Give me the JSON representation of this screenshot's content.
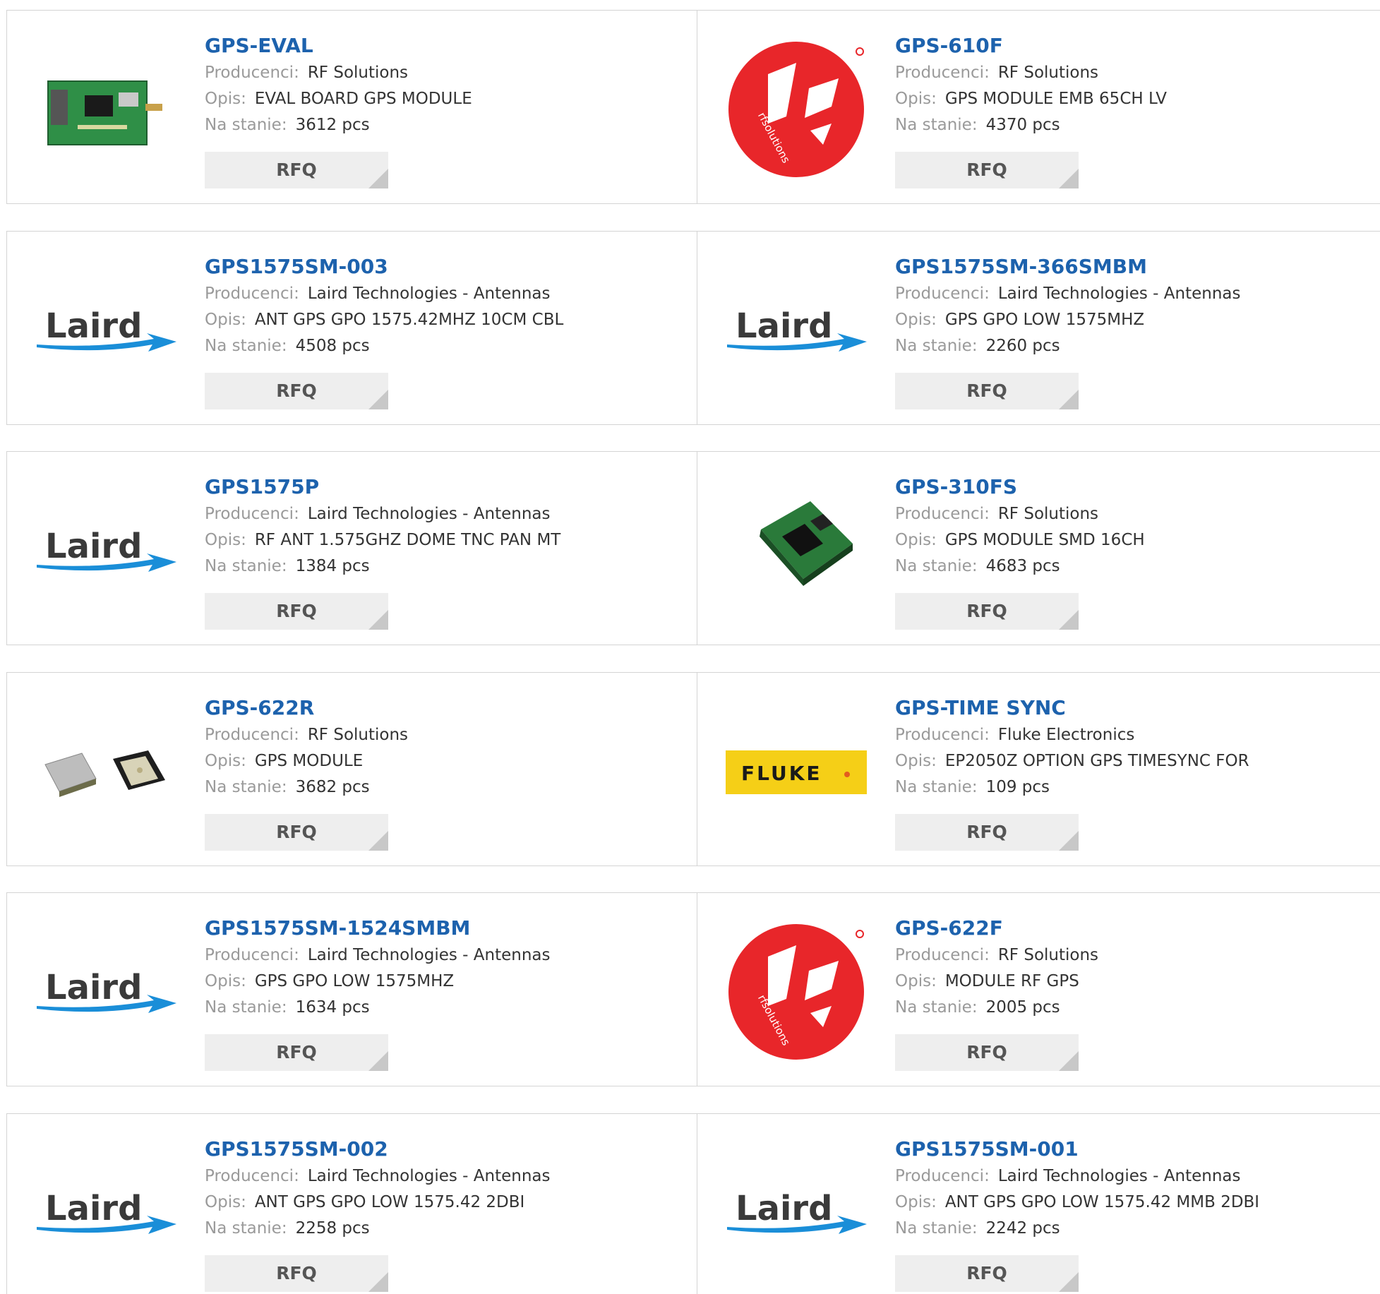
{
  "labels": {
    "manufacturer": "Producenci:",
    "description": "Opis:",
    "stock": "Na stanie:"
  },
  "colors": {
    "part_link": "#1d62ad",
    "rf_red": "#e8262a",
    "laird_blue": "#1a8ed8",
    "fluke_yellow": "#f5cf17"
  },
  "products": [
    {
      "part": "GPS-EVAL",
      "manufacturer": "RF Solutions",
      "description": "EVAL BOARD GPS MODULE",
      "stock": "3612 pcs",
      "rfq": "RFQ",
      "image": "eval-board-photo"
    },
    {
      "part": "GPS-610F",
      "manufacturer": "RF Solutions",
      "description": "GPS MODULE EMB 65CH LV",
      "stock": "4370 pcs",
      "rfq": "RFQ",
      "image": "rf-solutions-logo"
    },
    {
      "part": "GPS1575SM-003",
      "manufacturer": "Laird Technologies - Antennas",
      "description": "ANT GPS GPO 1575.42MHZ 10CM CBL",
      "stock": "4508 pcs",
      "rfq": "RFQ",
      "image": "laird-logo"
    },
    {
      "part": "GPS1575SM-366SMBM",
      "manufacturer": "Laird Technologies - Antennas",
      "description": "GPS GPO LOW 1575MHZ",
      "stock": "2260 pcs",
      "rfq": "RFQ",
      "image": "laird-logo"
    },
    {
      "part": "GPS1575P",
      "manufacturer": "Laird Technologies - Antennas",
      "description": "RF ANT 1.575GHZ DOME TNC PAN MT",
      "stock": "1384 pcs",
      "rfq": "RFQ",
      "image": "laird-logo"
    },
    {
      "part": "GPS-310FS",
      "manufacturer": "RF Solutions",
      "description": "GPS MODULE SMD 16CH",
      "stock": "4683 pcs",
      "rfq": "RFQ",
      "image": "gps-module-photo"
    },
    {
      "part": "GPS-622R",
      "manufacturer": "RF Solutions",
      "description": "GPS MODULE",
      "stock": "3682 pcs",
      "rfq": "RFQ",
      "image": "gps-622r-photo"
    },
    {
      "part": "GPS-TIME SYNC",
      "manufacturer": "Fluke Electronics",
      "description": "EP2050Z OPTION GPS TIMESYNC FOR",
      "stock": "109 pcs",
      "rfq": "RFQ",
      "image": "fluke-logo"
    },
    {
      "part": "GPS1575SM-1524SMBM",
      "manufacturer": "Laird Technologies - Antennas",
      "description": "GPS GPO LOW 1575MHZ",
      "stock": "1634 pcs",
      "rfq": "RFQ",
      "image": "laird-logo"
    },
    {
      "part": "GPS-622F",
      "manufacturer": "RF Solutions",
      "description": "MODULE RF GPS",
      "stock": "2005 pcs",
      "rfq": "RFQ",
      "image": "rf-solutions-logo"
    },
    {
      "part": "GPS1575SM-002",
      "manufacturer": "Laird Technologies - Antennas",
      "description": "ANT GPS GPO LOW 1575.42 2DBI",
      "stock": "2258 pcs",
      "rfq": "RFQ",
      "image": "laird-logo"
    },
    {
      "part": "GPS1575SM-001",
      "manufacturer": "Laird Technologies - Antennas",
      "description": "ANT GPS GPO LOW 1575.42 MMB 2DBI",
      "stock": "2242 pcs",
      "rfq": "RFQ",
      "image": "laird-logo"
    }
  ],
  "logos": {
    "laird": "Laird",
    "fluke": "FLUKE",
    "rf": "RF",
    "rf_tagline": "rfsolutions"
  }
}
